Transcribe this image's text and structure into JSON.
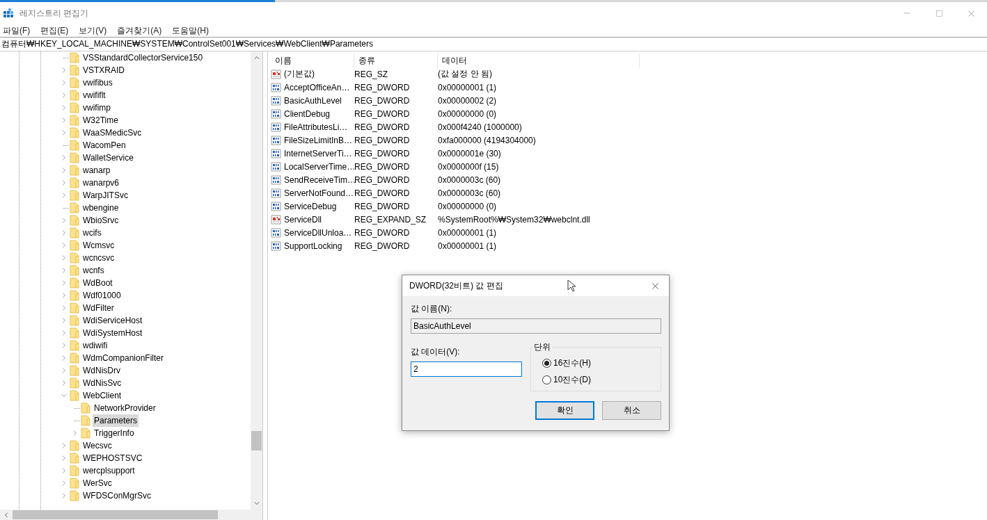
{
  "window": {
    "title": "레지스트리 편집기"
  },
  "menu": [
    "파일(F)",
    "편집(E)",
    "보기(V)",
    "즐겨찾기(A)",
    "도움말(H)"
  ],
  "address": "컴퓨터₩HKEY_LOCAL_MACHINE₩SYSTEM₩ControlSet001₩Services₩WebClient₩Parameters",
  "tree": [
    {
      "label": "VSStandardCollectorService150",
      "kind": "leaf",
      "selected": false
    },
    {
      "label": "VSTXRAID",
      "kind": "closed",
      "selected": false
    },
    {
      "label": "vwifibus",
      "kind": "closed",
      "selected": false
    },
    {
      "label": "vwififlt",
      "kind": "closed",
      "selected": false
    },
    {
      "label": "vwifimp",
      "kind": "closed",
      "selected": false
    },
    {
      "label": "W32Time",
      "kind": "closed",
      "selected": false
    },
    {
      "label": "WaaSMedicSvc",
      "kind": "closed",
      "selected": false
    },
    {
      "label": "WacomPen",
      "kind": "leaf",
      "selected": false
    },
    {
      "label": "WalletService",
      "kind": "closed",
      "selected": false
    },
    {
      "label": "wanarp",
      "kind": "closed",
      "selected": false
    },
    {
      "label": "wanarpv6",
      "kind": "closed",
      "selected": false
    },
    {
      "label": "WarpJITSvc",
      "kind": "closed",
      "selected": false
    },
    {
      "label": "wbengine",
      "kind": "leaf",
      "selected": false
    },
    {
      "label": "WbioSrvc",
      "kind": "closed",
      "selected": false
    },
    {
      "label": "wcifs",
      "kind": "closed",
      "selected": false
    },
    {
      "label": "Wcmsvc",
      "kind": "closed",
      "selected": false
    },
    {
      "label": "wcncsvc",
      "kind": "closed",
      "selected": false
    },
    {
      "label": "wcnfs",
      "kind": "closed",
      "selected": false
    },
    {
      "label": "WdBoot",
      "kind": "closed",
      "selected": false
    },
    {
      "label": "Wdf01000",
      "kind": "closed",
      "selected": false
    },
    {
      "label": "WdFilter",
      "kind": "closed",
      "selected": false
    },
    {
      "label": "WdiServiceHost",
      "kind": "closed",
      "selected": false
    },
    {
      "label": "WdiSystemHost",
      "kind": "closed",
      "selected": false
    },
    {
      "label": "wdiwifi",
      "kind": "closed",
      "selected": false
    },
    {
      "label": "WdmCompanionFilter",
      "kind": "closed",
      "selected": false
    },
    {
      "label": "WdNisDrv",
      "kind": "closed",
      "selected": false
    },
    {
      "label": "WdNisSvc",
      "kind": "closed",
      "selected": false
    },
    {
      "label": "WebClient",
      "kind": "open",
      "selected": false,
      "children": [
        {
          "label": "NetworkProvider",
          "kind": "leaf",
          "selected": false
        },
        {
          "label": "Parameters",
          "kind": "leaf",
          "selected": true
        },
        {
          "label": "TriggerInfo",
          "kind": "closed",
          "selected": false
        }
      ]
    },
    {
      "label": "Wecsvc",
      "kind": "closed",
      "selected": false
    },
    {
      "label": "WEPHOSTSVC",
      "kind": "closed",
      "selected": false
    },
    {
      "label": "wercplsupport",
      "kind": "closed",
      "selected": false
    },
    {
      "label": "WerSvc",
      "kind": "closed",
      "selected": false
    },
    {
      "label": "WFDSConMgrSvc",
      "kind": "closed",
      "selected": false
    }
  ],
  "list": {
    "columns": [
      "이름",
      "종류",
      "데이터"
    ],
    "rows": [
      {
        "kind": "string",
        "name": "(기본값)",
        "type": "REG_SZ",
        "data": "(값 설정 안 됨)"
      },
      {
        "kind": "binary",
        "name": "AcceptOfficeAn…",
        "type": "REG_DWORD",
        "data": "0x00000001 (1)"
      },
      {
        "kind": "binary",
        "name": "BasicAuthLevel",
        "type": "REG_DWORD",
        "data": "0x00000002 (2)"
      },
      {
        "kind": "binary",
        "name": "ClientDebug",
        "type": "REG_DWORD",
        "data": "0x00000000 (0)"
      },
      {
        "kind": "binary",
        "name": "FileAttributesLi…",
        "type": "REG_DWORD",
        "data": "0x000f4240 (1000000)"
      },
      {
        "kind": "binary",
        "name": "FileSizeLimitInB…",
        "type": "REG_DWORD",
        "data": "0xfa000000 (4194304000)"
      },
      {
        "kind": "binary",
        "name": "InternetServerTi…",
        "type": "REG_DWORD",
        "data": "0x0000001e (30)"
      },
      {
        "kind": "binary",
        "name": "LocalServerTime…",
        "type": "REG_DWORD",
        "data": "0x0000000f (15)"
      },
      {
        "kind": "binary",
        "name": "SendReceiveTim…",
        "type": "REG_DWORD",
        "data": "0x0000003c (60)"
      },
      {
        "kind": "binary",
        "name": "ServerNotFound…",
        "type": "REG_DWORD",
        "data": "0x0000003c (60)"
      },
      {
        "kind": "binary",
        "name": "ServiceDebug",
        "type": "REG_DWORD",
        "data": "0x00000000 (0)"
      },
      {
        "kind": "string",
        "name": "ServiceDll",
        "type": "REG_EXPAND_SZ",
        "data": "%SystemRoot%₩System32₩webclnt.dll"
      },
      {
        "kind": "binary",
        "name": "ServiceDllUnloa…",
        "type": "REG_DWORD",
        "data": "0x00000001 (1)"
      },
      {
        "kind": "binary",
        "name": "SupportLocking",
        "type": "REG_DWORD",
        "data": "0x00000001 (1)"
      }
    ]
  },
  "dialog": {
    "title": "DWORD(32비트) 값 편집",
    "name_label": "값 이름(N):",
    "name_value": "BasicAuthLevel",
    "data_label": "값 데이터(V):",
    "data_value": "2",
    "base_legend": "단위",
    "bases": [
      {
        "label": "16진수(H)",
        "selected": true
      },
      {
        "label": "10진수(D)",
        "selected": false
      }
    ],
    "buttons": [
      {
        "label": "확인",
        "default": true
      },
      {
        "label": "취소",
        "default": false
      }
    ]
  }
}
